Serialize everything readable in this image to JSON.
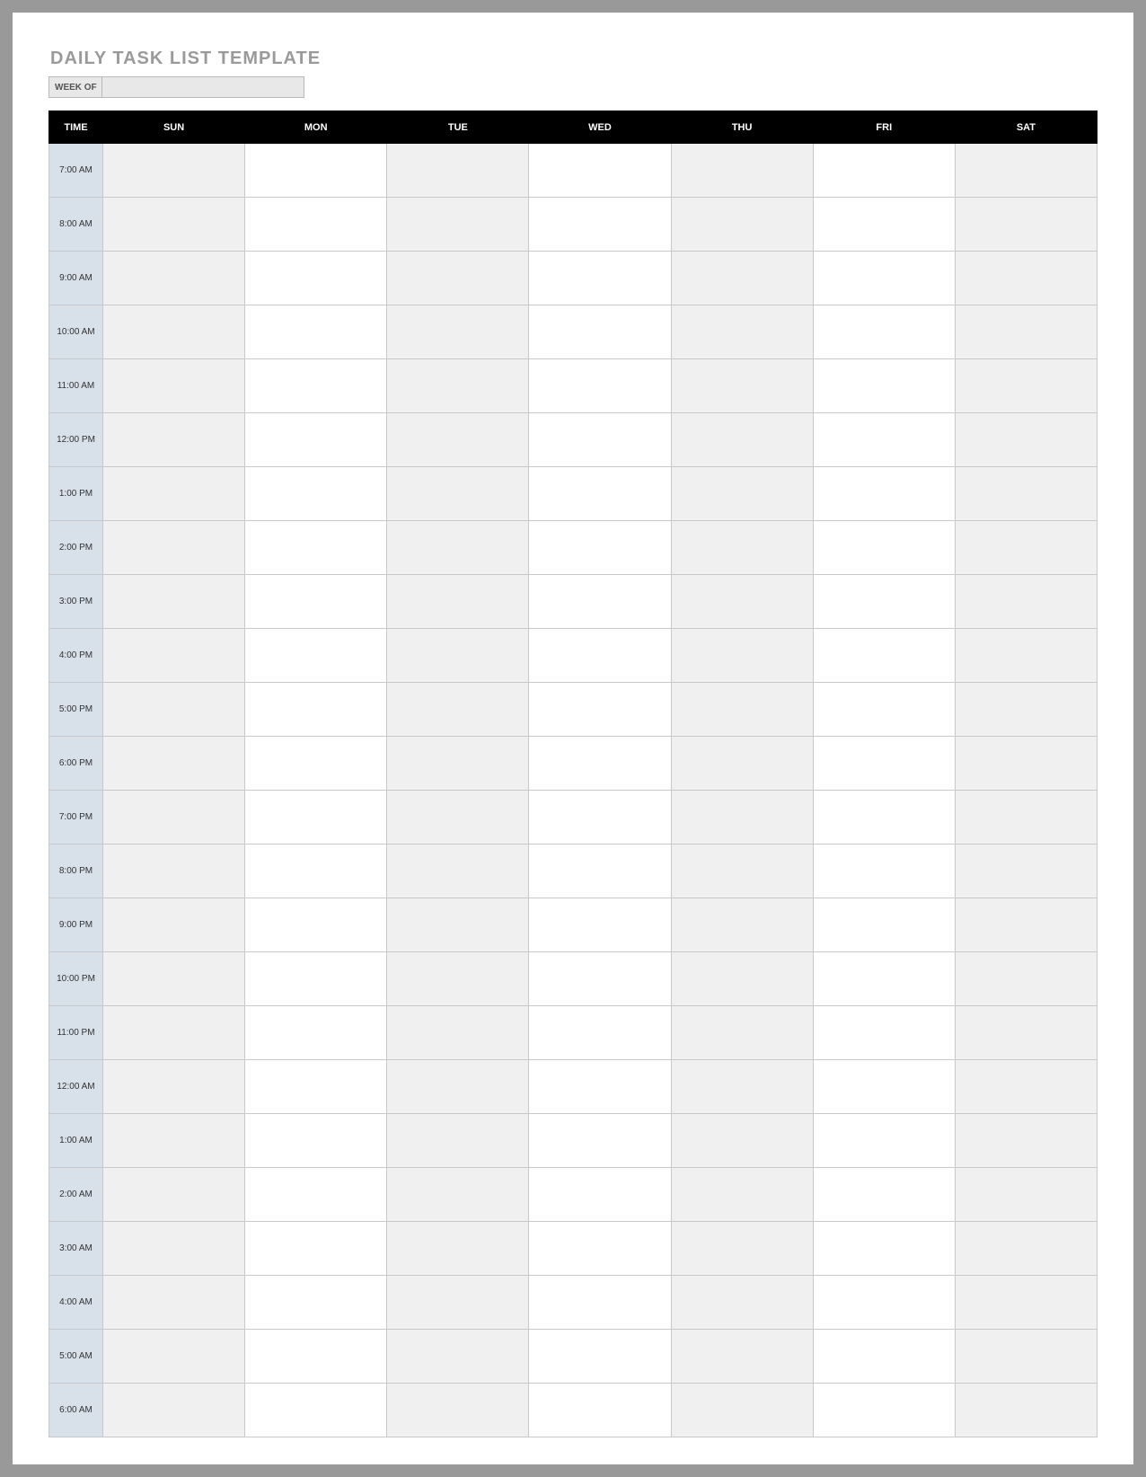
{
  "title": "DAILY TASK LIST TEMPLATE",
  "weekof": {
    "label": "WEEK OF",
    "value": ""
  },
  "headers": {
    "time": "TIME",
    "days": [
      "SUN",
      "MON",
      "TUE",
      "WED",
      "THU",
      "FRI",
      "SAT"
    ]
  },
  "times": [
    "7:00 AM",
    "8:00 AM",
    "9:00 AM",
    "10:00 AM",
    "11:00 AM",
    "12:00 PM",
    "1:00 PM",
    "2:00 PM",
    "3:00 PM",
    "4:00 PM",
    "5:00 PM",
    "6:00 PM",
    "7:00 PM",
    "8:00 PM",
    "9:00 PM",
    "10:00 PM",
    "11:00 PM",
    "12:00 AM",
    "1:00 AM",
    "2:00 AM",
    "3:00 AM",
    "4:00 AM",
    "5:00 AM",
    "6:00 AM"
  ],
  "cells": {}
}
